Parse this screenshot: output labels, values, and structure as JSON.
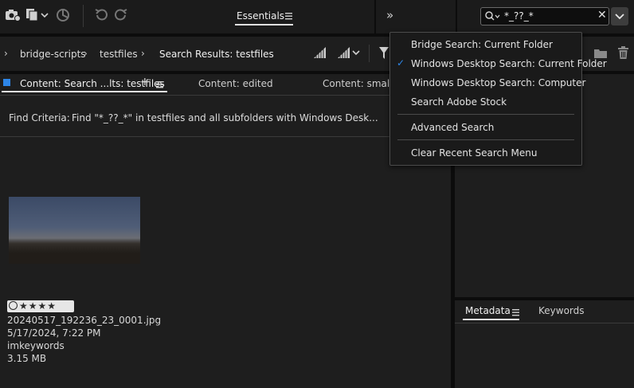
{
  "toolbar": {
    "workspace_label": "Essentials",
    "search_value": "*_??_*"
  },
  "path": {
    "items": [
      "bridge-scripts",
      "testfiles",
      "Search Results: testfiles"
    ]
  },
  "content_tabs": {
    "tab1": "Content: Search ...lts: testfiles",
    "tab2": "Content: edited",
    "tab3": "Content: small"
  },
  "find": {
    "label": "Find Criteria:",
    "text": "Find \"*_??_*\" in testfiles and all subfolders with Windows Desk..."
  },
  "item": {
    "filename": "20240517_192236_23_0001.jpg",
    "date": "5/17/2024, 7:22 PM",
    "keywords": "imkeywords",
    "size": "3.15 MB",
    "rating": "★★★★"
  },
  "panels": {
    "metadata": "Metadata",
    "keywords": "Keywords"
  },
  "search_menu": {
    "items": [
      "Bridge Search: Current Folder",
      "Windows Desktop Search: Current Folder",
      "Windows Desktop Search: Computer",
      "Search Adobe Stock",
      "Advanced Search",
      "Clear Recent Search Menu"
    ]
  },
  "colors": {
    "accent": "#2d86e8",
    "background": "#1e1e1e"
  }
}
